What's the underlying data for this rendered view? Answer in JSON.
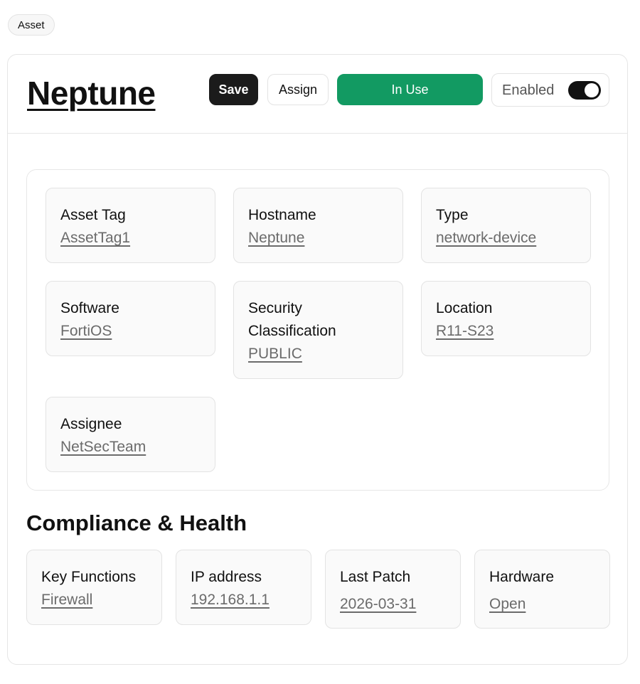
{
  "breadcrumb_badge": "Asset",
  "asset": {
    "title": "Neptune",
    "actions": {
      "save_label": "Save",
      "assign_label": "Assign",
      "status_label": "In Use"
    },
    "toggle": {
      "label": "Enabled",
      "on": true
    }
  },
  "details": [
    {
      "label": "Asset Tag",
      "value": "AssetTag1"
    },
    {
      "label": "Hostname",
      "value": "Neptune"
    },
    {
      "label": "Type",
      "value": "network-device"
    },
    {
      "label": "Software",
      "value": "FortiOS"
    },
    {
      "label": "Security Classification",
      "value": "PUBLIC"
    },
    {
      "label": "Location",
      "value": "R11-S23"
    },
    {
      "label": "Assignee",
      "value": "NetSecTeam"
    }
  ],
  "compliance": {
    "title": "Compliance & Health",
    "items": [
      {
        "label": "Key Functions",
        "value": "Firewall"
      },
      {
        "label": "IP address",
        "value": "192.168.1.1"
      },
      {
        "label": "Last Patch",
        "value": "2026-03-31"
      },
      {
        "label": "Hardware",
        "value": "Open"
      }
    ]
  },
  "colors": {
    "status_green": "#129a62",
    "primary_dark": "#1b1b1b"
  }
}
